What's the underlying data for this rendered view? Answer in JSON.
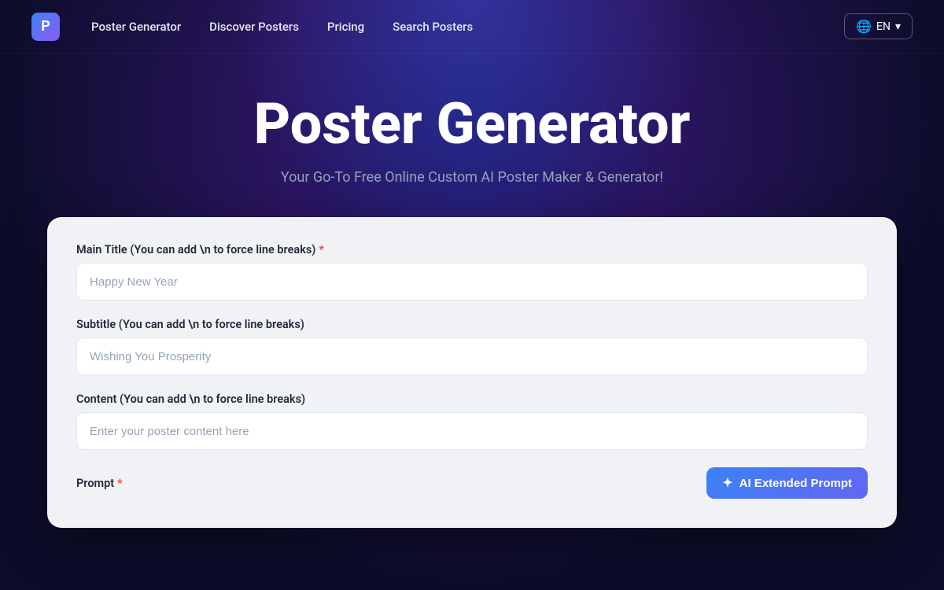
{
  "nav": {
    "logo_text": "P",
    "links": [
      {
        "label": "Poster Generator",
        "id": "nav-poster-generator"
      },
      {
        "label": "Discover Posters",
        "id": "nav-discover-posters"
      },
      {
        "label": "Pricing",
        "id": "nav-pricing"
      },
      {
        "label": "Search Posters",
        "id": "nav-search-posters"
      }
    ],
    "lang": {
      "code": "EN",
      "chevron": "▾"
    }
  },
  "hero": {
    "title": "Poster Generator",
    "subtitle": "Your Go-To Free Online Custom AI Poster Maker & Generator!"
  },
  "form": {
    "main_title": {
      "label": "Main Title (You can add \\n to force line breaks)",
      "placeholder": "Happy New Year",
      "required": true
    },
    "subtitle": {
      "label": "Subtitle (You can add \\n to force line breaks)",
      "placeholder": "Wishing You Prosperity",
      "required": false
    },
    "content": {
      "label": "Content (You can add \\n to force line breaks)",
      "placeholder": "Enter your poster content here",
      "required": false
    },
    "prompt": {
      "label": "Prompt",
      "required": true,
      "ai_button_label": "AI Extended Prompt"
    }
  }
}
